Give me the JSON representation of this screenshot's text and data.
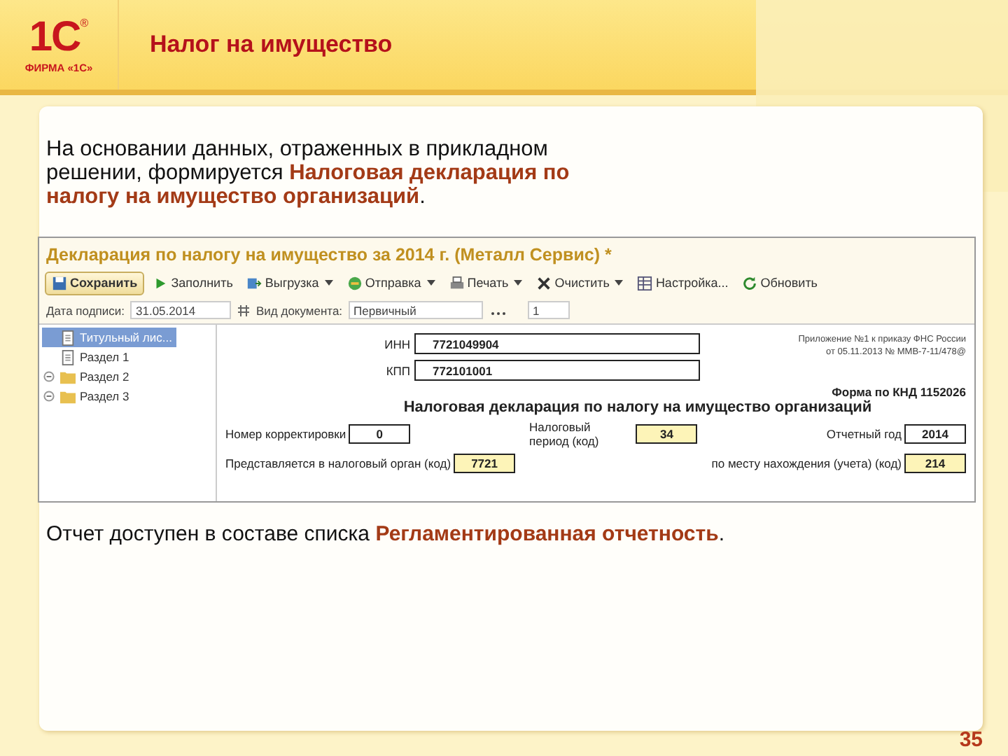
{
  "logo": {
    "mark": "1С",
    "registered": "®",
    "caption": "ФИРМА «1С»"
  },
  "slide_title": "Налог на имущество",
  "intro": "На основании данных, отраженных в прикладном решении, формируется **Налоговая декларация по налогу на имущество организаций**.",
  "app_window": {
    "title": "Декларация по налогу на имущество за 2014 г. (Металл Сервис) *",
    "toolbar": [
      {
        "label": "Сохранить",
        "kind": "save",
        "dropdown": false,
        "primary": true
      },
      {
        "label": "Заполнить",
        "kind": "play",
        "dropdown": false,
        "primary": false
      },
      {
        "label": "Выгрузка",
        "kind": "export",
        "dropdown": true,
        "primary": false
      },
      {
        "label": "Отправка",
        "kind": "send",
        "dropdown": true,
        "primary": false
      },
      {
        "label": "Печать",
        "kind": "print",
        "dropdown": true,
        "primary": false
      },
      {
        "label": "Очистить",
        "kind": "clear",
        "dropdown": true,
        "primary": false
      },
      {
        "label": "Настройка...",
        "kind": "settings",
        "dropdown": false,
        "primary": false
      },
      {
        "label": "Обновить",
        "kind": "refresh",
        "dropdown": false,
        "primary": false
      }
    ],
    "sign_date_label": "Дата подписи:",
    "sign_date": "31.05.2014",
    "doc_type_label": "Вид документа:",
    "doc_type": "Первичный",
    "doc_number": "1",
    "tree": [
      {
        "label": "Титульный лис...",
        "kind": "page",
        "selected": true
      },
      {
        "label": "Раздел 1",
        "kind": "page",
        "selected": false
      },
      {
        "label": "Раздел 2",
        "kind": "folder",
        "selected": false
      },
      {
        "label": "Раздел 3",
        "kind": "folder",
        "selected": false
      }
    ],
    "form": {
      "inn_label": "ИНН",
      "inn": "7721049904",
      "kpp_label": "КПП",
      "kpp": "772101001",
      "appendix": [
        "Приложение №1 к приказу ФНС России",
        "от 05.11.2013 № ММВ-7-11/478@"
      ],
      "form_code": "Форма по КНД 1152026",
      "heading": "Налоговая декларация по налогу на имущество организаций",
      "rows": [
        [
          {
            "label": "Номер корректировки",
            "value": "0",
            "highlighted": false
          },
          {
            "label": "Налоговый период (код)",
            "value": "34",
            "highlighted": true
          },
          {
            "label": "Отчетный год",
            "value": "2014",
            "highlighted": false
          }
        ],
        [
          {
            "label": "Представляется в налоговый орган (код)",
            "value": "7721",
            "highlighted": true
          },
          "",
          {
            "label": "по месту нахождения (учета) (код)",
            "value": "214",
            "highlighted": true
          }
        ]
      ]
    }
  },
  "footer_text": "Отчет доступен в составе списка **Регламентированная отчетность**.",
  "page_number": "35"
}
